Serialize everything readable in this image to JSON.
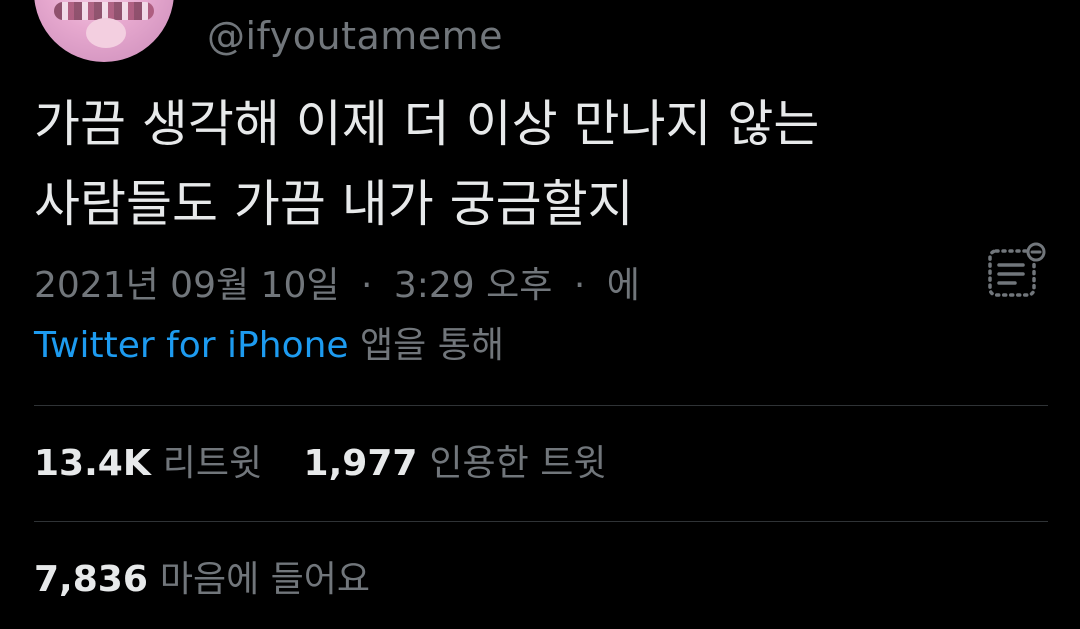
{
  "author": {
    "handle": "@ifyoutameme",
    "avatar_icon": "profile-avatar"
  },
  "tweet": {
    "text_line1": "가끔 생각해 이제 더 이상 만나지 않는",
    "text_line2": "사람들도 가끔 내가 궁금할지",
    "date": "2021년 09월 10일",
    "dot1": "·",
    "time": "3:29 오후",
    "dot2": "·",
    "via_prefix": "에",
    "source": "Twitter for iPhone",
    "source_suffix": "앱을 통해"
  },
  "stats": {
    "retweets_count": "13.4K",
    "retweets_label": "리트윗",
    "quotes_count": "1,977",
    "quotes_label": "인용한 트윗",
    "likes_count": "7,836",
    "likes_label": "마음에 들어요"
  },
  "icons": {
    "analytics": "analytics-icon"
  },
  "colors": {
    "background": "#000000",
    "text_primary": "#e7e9ea",
    "text_secondary": "#71767b",
    "link": "#1d9bf0",
    "divider": "#2f3336"
  }
}
